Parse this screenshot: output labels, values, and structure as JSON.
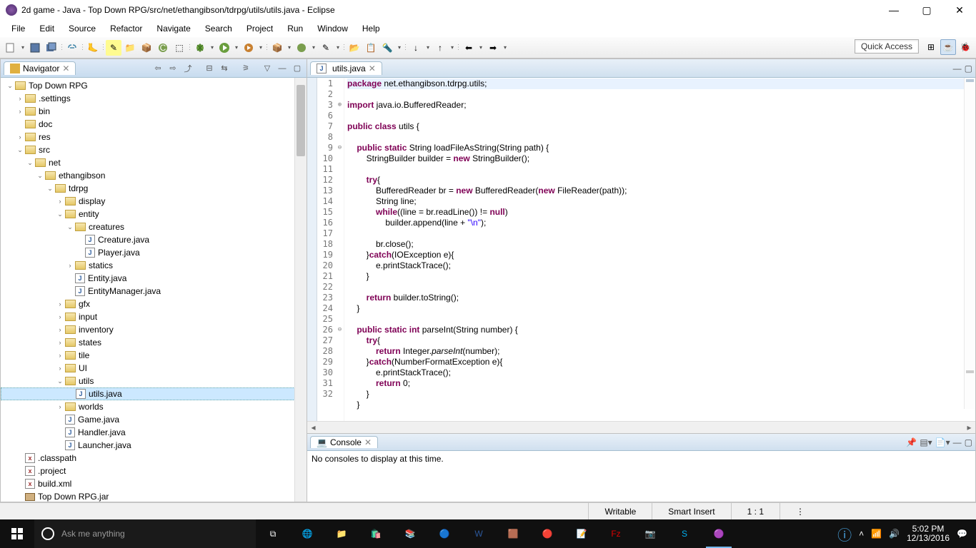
{
  "window": {
    "title": "2d game - Java - Top Down RPG/src/net/ethangibson/tdrpg/utils/utils.java - Eclipse"
  },
  "menubar": [
    "File",
    "Edit",
    "Source",
    "Refactor",
    "Navigate",
    "Search",
    "Project",
    "Run",
    "Window",
    "Help"
  ],
  "quick_access": "Quick Access",
  "navigator": {
    "title": "Navigator",
    "tree": [
      {
        "d": 0,
        "exp": "open",
        "icon": "fold-open",
        "label": "Top Down RPG"
      },
      {
        "d": 1,
        "exp": "closed",
        "icon": "fold-closed",
        "label": ".settings"
      },
      {
        "d": 1,
        "exp": "closed",
        "icon": "fold-closed",
        "label": "bin"
      },
      {
        "d": 1,
        "exp": "none",
        "icon": "fold-closed",
        "label": "doc"
      },
      {
        "d": 1,
        "exp": "closed",
        "icon": "fold-closed",
        "label": "res"
      },
      {
        "d": 1,
        "exp": "open",
        "icon": "fold-open",
        "label": "src"
      },
      {
        "d": 2,
        "exp": "open",
        "icon": "fold-open",
        "label": "net"
      },
      {
        "d": 3,
        "exp": "open",
        "icon": "fold-open",
        "label": "ethangibson"
      },
      {
        "d": 4,
        "exp": "open",
        "icon": "fold-open",
        "label": "tdrpg"
      },
      {
        "d": 5,
        "exp": "closed",
        "icon": "fold-closed",
        "label": "display"
      },
      {
        "d": 5,
        "exp": "open",
        "icon": "fold-open",
        "label": "entity"
      },
      {
        "d": 6,
        "exp": "open",
        "icon": "fold-open",
        "label": "creatures"
      },
      {
        "d": 7,
        "exp": "none",
        "icon": "jfile",
        "label": "Creature.java"
      },
      {
        "d": 7,
        "exp": "none",
        "icon": "jfile",
        "label": "Player.java"
      },
      {
        "d": 6,
        "exp": "closed",
        "icon": "fold-closed",
        "label": "statics"
      },
      {
        "d": 6,
        "exp": "none",
        "icon": "jfile",
        "label": "Entity.java"
      },
      {
        "d": 6,
        "exp": "none",
        "icon": "jfile",
        "label": "EntityManager.java"
      },
      {
        "d": 5,
        "exp": "closed",
        "icon": "fold-closed",
        "label": "gfx"
      },
      {
        "d": 5,
        "exp": "closed",
        "icon": "fold-closed",
        "label": "input"
      },
      {
        "d": 5,
        "exp": "closed",
        "icon": "fold-closed",
        "label": "inventory"
      },
      {
        "d": 5,
        "exp": "closed",
        "icon": "fold-closed",
        "label": "states"
      },
      {
        "d": 5,
        "exp": "closed",
        "icon": "fold-closed",
        "label": "tile"
      },
      {
        "d": 5,
        "exp": "closed",
        "icon": "fold-closed",
        "label": "UI"
      },
      {
        "d": 5,
        "exp": "open",
        "icon": "fold-open",
        "label": "utils"
      },
      {
        "d": 6,
        "exp": "none",
        "icon": "jfile",
        "label": "utils.java",
        "selected": true
      },
      {
        "d": 5,
        "exp": "closed",
        "icon": "fold-closed",
        "label": "worlds"
      },
      {
        "d": 5,
        "exp": "none",
        "icon": "jfile",
        "label": "Game.java"
      },
      {
        "d": 5,
        "exp": "none",
        "icon": "jfile",
        "label": "Handler.java"
      },
      {
        "d": 5,
        "exp": "none",
        "icon": "jfile",
        "label": "Launcher.java"
      },
      {
        "d": 1,
        "exp": "none",
        "icon": "xfile",
        "label": ".classpath"
      },
      {
        "d": 1,
        "exp": "none",
        "icon": "xfile",
        "label": ".project"
      },
      {
        "d": 1,
        "exp": "none",
        "icon": "xfile",
        "label": "build.xml"
      },
      {
        "d": 1,
        "exp": "none",
        "icon": "jar",
        "label": "Top Down RPG.jar"
      }
    ]
  },
  "editor": {
    "tab": "utils.java",
    "line_numbers": [
      1,
      2,
      3,
      6,
      7,
      8,
      9,
      10,
      11,
      12,
      13,
      14,
      15,
      16,
      17,
      18,
      19,
      20,
      21,
      22,
      23,
      24,
      25,
      26,
      27,
      28,
      29,
      30,
      31,
      32
    ],
    "fold_marks": {
      "1": "",
      "2": "",
      "3": "⊕",
      "4": "",
      "5": "",
      "6": "",
      "7": "⊖",
      "8": "",
      "9": "",
      "10": "",
      "11": "",
      "12": "",
      "13": "",
      "14": "",
      "15": "",
      "16": "",
      "17": "",
      "18": "",
      "19": "",
      "20": "",
      "21": "",
      "22": "",
      "23": "",
      "24": "⊖",
      "25": "",
      "26": "",
      "27": "",
      "28": "",
      "29": "",
      "30": ""
    }
  },
  "code": {
    "l1_a": "package",
    "l1_b": " net.ethangibson.tdrpg.utils;",
    "l3_a": "import",
    "l3_b": " java.io.BufferedReader;",
    "l7_a": "public",
    "l7_b": " ",
    "l7_c": "class",
    "l7_d": " utils {",
    "l9_a": "    ",
    "l9_b": "public",
    "l9_c": " ",
    "l9_d": "static",
    "l9_e": " String loadFileAsString(String path) {",
    "l10_a": "        StringBuilder builder = ",
    "l10_b": "new",
    "l10_c": " StringBuilder();",
    "l12_a": "        ",
    "l12_b": "try",
    "l12_c": "{",
    "l13_a": "            BufferedReader br = ",
    "l13_b": "new",
    "l13_c": " BufferedReader(",
    "l13_d": "new",
    "l13_e": " FileReader(path));",
    "l14": "            String line;",
    "l15_a": "            ",
    "l15_b": "while",
    "l15_c": "((line = br.readLine()) != ",
    "l15_d": "null",
    "l15_e": ")",
    "l16_a": "                builder.append(line + ",
    "l16_b": "\"\\n\"",
    "l16_c": ");",
    "l18": "            br.close();",
    "l19_a": "        }",
    "l19_b": "catch",
    "l19_c": "(IOException e){",
    "l20": "            e.printStackTrace();",
    "l21": "        }",
    "l23_a": "        ",
    "l23_b": "return",
    "l23_c": " builder.toString();",
    "l24": "    }",
    "l26_a": "    ",
    "l26_b": "public",
    "l26_c": " ",
    "l26_d": "static",
    "l26_e": " ",
    "l26_f": "int",
    "l26_g": " parseInt(String number) {",
    "l27_a": "        ",
    "l27_b": "try",
    "l27_c": "{",
    "l28_a": "            ",
    "l28_b": "return",
    "l28_c": " Integer.",
    "l28_d": "parseInt",
    "l28_e": "(number);",
    "l29_a": "        }",
    "l29_b": "catch",
    "l29_c": "(NumberFormatException e){",
    "l30": "            e.printStackTrace();",
    "l31_a": "            ",
    "l31_b": "return",
    "l31_c": " 0;",
    "l32": "        }",
    "l33": "    }"
  },
  "console": {
    "title": "Console",
    "message": "No consoles to display at this time."
  },
  "statusbar": {
    "writable": "Writable",
    "insert": "Smart Insert",
    "pos": "1 : 1"
  },
  "taskbar": {
    "search_placeholder": "Ask me anything",
    "time": "5:02 PM",
    "date": "12/13/2016"
  }
}
